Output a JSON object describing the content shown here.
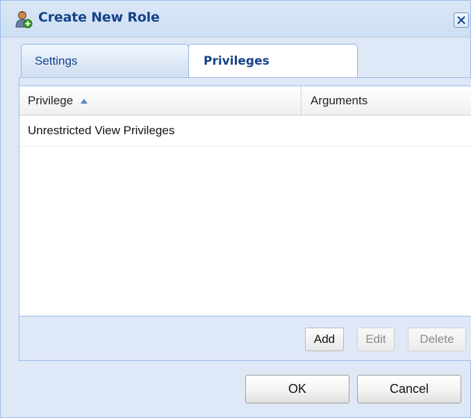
{
  "dialog": {
    "title": "Create New Role",
    "title_icon": "user-add-icon",
    "close_icon": "close-icon"
  },
  "tabs": [
    {
      "label": "Settings",
      "active": false
    },
    {
      "label": "Privileges",
      "active": true
    }
  ],
  "grid": {
    "columns": [
      {
        "label": "Privilege",
        "sort": "ascending"
      },
      {
        "label": "Arguments"
      }
    ],
    "rows": [
      {
        "privilege": "Unrestricted View Privileges",
        "arguments": ""
      }
    ],
    "buttons": {
      "add": "Add",
      "edit": "Edit",
      "delete": "Delete"
    }
  },
  "footer": {
    "ok": "OK",
    "cancel": "Cancel"
  },
  "colors": {
    "title_text": "#15428b",
    "panel_background": "#dfe8f6",
    "border": "#99bbe8"
  }
}
